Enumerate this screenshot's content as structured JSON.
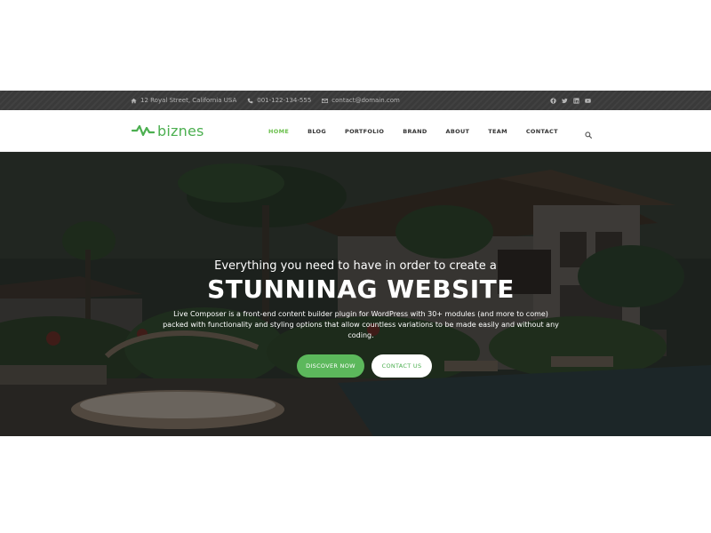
{
  "topbar": {
    "address": "12 Royal Street, California USA",
    "phone": "001-122-134-555",
    "email": "contact@domain.com",
    "social_icons": [
      "facebook-icon",
      "twitter-icon",
      "linkedin-icon",
      "youtube-icon"
    ]
  },
  "navbar": {
    "logo_text": "biznes",
    "menu": [
      {
        "label": "HOME",
        "active": true
      },
      {
        "label": "BLOG",
        "active": false
      },
      {
        "label": "PORTFOLIO",
        "active": false
      },
      {
        "label": "BRAND",
        "active": false
      },
      {
        "label": "ABOUT",
        "active": false
      },
      {
        "label": "TEAM",
        "active": false
      },
      {
        "label": "CONTACT",
        "active": false
      }
    ],
    "search_icon": "search-icon"
  },
  "hero": {
    "subtitle": "Everything you need to have in order to create a",
    "title": "STUNNINAG WEBSITE",
    "description": "Live Composer is a front-end content builder plugin for WordPress with 30+ modules (and more to come) packed with functionality and styling options that allow countless variations to be made easily and without any coding.",
    "primary_button": "DISCOVER NOW",
    "secondary_button": "CONTACT US"
  },
  "colors": {
    "brand_green": "#4caf50",
    "active_menu": "#6abf4b",
    "topbar_bg": "#3a3a3a",
    "button_green": "#5cb85c"
  }
}
